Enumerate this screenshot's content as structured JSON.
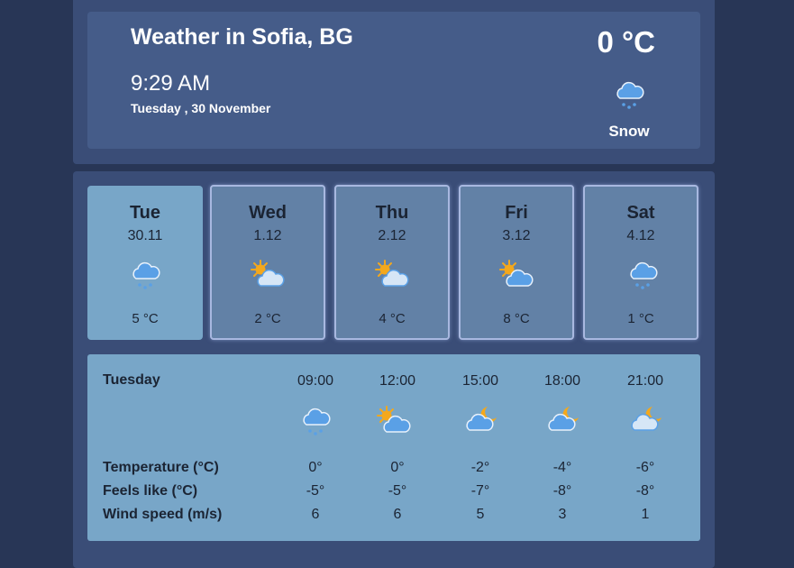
{
  "current": {
    "title": "Weather in Sofia, BG",
    "time": "9:29 AM",
    "date": "Tuesday , 30 November",
    "temperature": "0 °C",
    "condition": "Snow",
    "icon": "snow-icon"
  },
  "days": [
    {
      "name": "Tue",
      "date": "30.11",
      "temp": "5 °C",
      "icon": "snow-icon",
      "selected": true
    },
    {
      "name": "Wed",
      "date": "1.12",
      "temp": "2 °C",
      "icon": "partly-sunny-icon",
      "selected": false
    },
    {
      "name": "Thu",
      "date": "2.12",
      "temp": "4 °C",
      "icon": "partly-sunny-icon",
      "selected": false
    },
    {
      "name": "Fri",
      "date": "3.12",
      "temp": "8 °C",
      "icon": "partly-sunny-icon",
      "selected": false
    },
    {
      "name": "Sat",
      "date": "4.12",
      "temp": "1 °C",
      "icon": "snow-icon",
      "selected": false
    }
  ],
  "hourly": {
    "day": "Tuesday",
    "labels": {
      "temperature": "Temperature (°C)",
      "feels_like": "Feels like (°C)",
      "wind": "Wind speed (m/s)"
    },
    "times": [
      "09:00",
      "12:00",
      "15:00",
      "18:00",
      "21:00"
    ],
    "icons": [
      "snow-icon",
      "partly-sunny-icon",
      "night-cloudy-icon",
      "night-cloudy-icon",
      "night-partly-cloudy-icon"
    ],
    "temperature": [
      "0°",
      "0°",
      "-2°",
      "-4°",
      "-6°"
    ],
    "feels_like": [
      "-5°",
      "-5°",
      "-7°",
      "-8°",
      "-8°"
    ],
    "wind": [
      "6",
      "6",
      "5",
      "3",
      "1"
    ]
  },
  "colors": {
    "background": "#283656",
    "panel": "#3a4d77",
    "current_card": "#455c89",
    "day_card": "#6281a6",
    "day_card_selected": "#78a6c8",
    "hourly_card": "#78a6c8",
    "cloud_blue": "#5aa0e6",
    "sun": "#f4a81c"
  }
}
